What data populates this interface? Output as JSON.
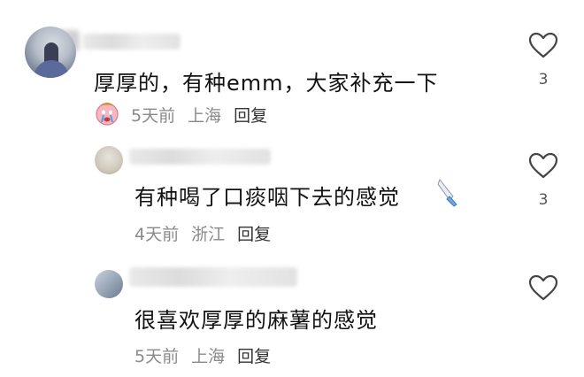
{
  "comments": [
    {
      "text": "厚厚的，有种emm，大家补充一下",
      "time": "5天前",
      "location": "上海",
      "reply_label": "回复",
      "like_count": "3",
      "avatar_badge_icon": "crying-face-emoji-icon"
    },
    {
      "text": "有种喝了口痰咽下去的感觉",
      "trailing_icon": "knife-emoji-icon",
      "time": "4天前",
      "location": "浙江",
      "reply_label": "回复",
      "like_count": "3"
    },
    {
      "text": "很喜欢厚厚的麻薯的感觉",
      "time": "5天前",
      "location": "上海",
      "reply_label": "回复",
      "like_count": ""
    }
  ],
  "colors": {
    "text": "#111111",
    "meta": "#8a8a8a",
    "reply": "#333333",
    "heart_stroke": "#444444"
  }
}
